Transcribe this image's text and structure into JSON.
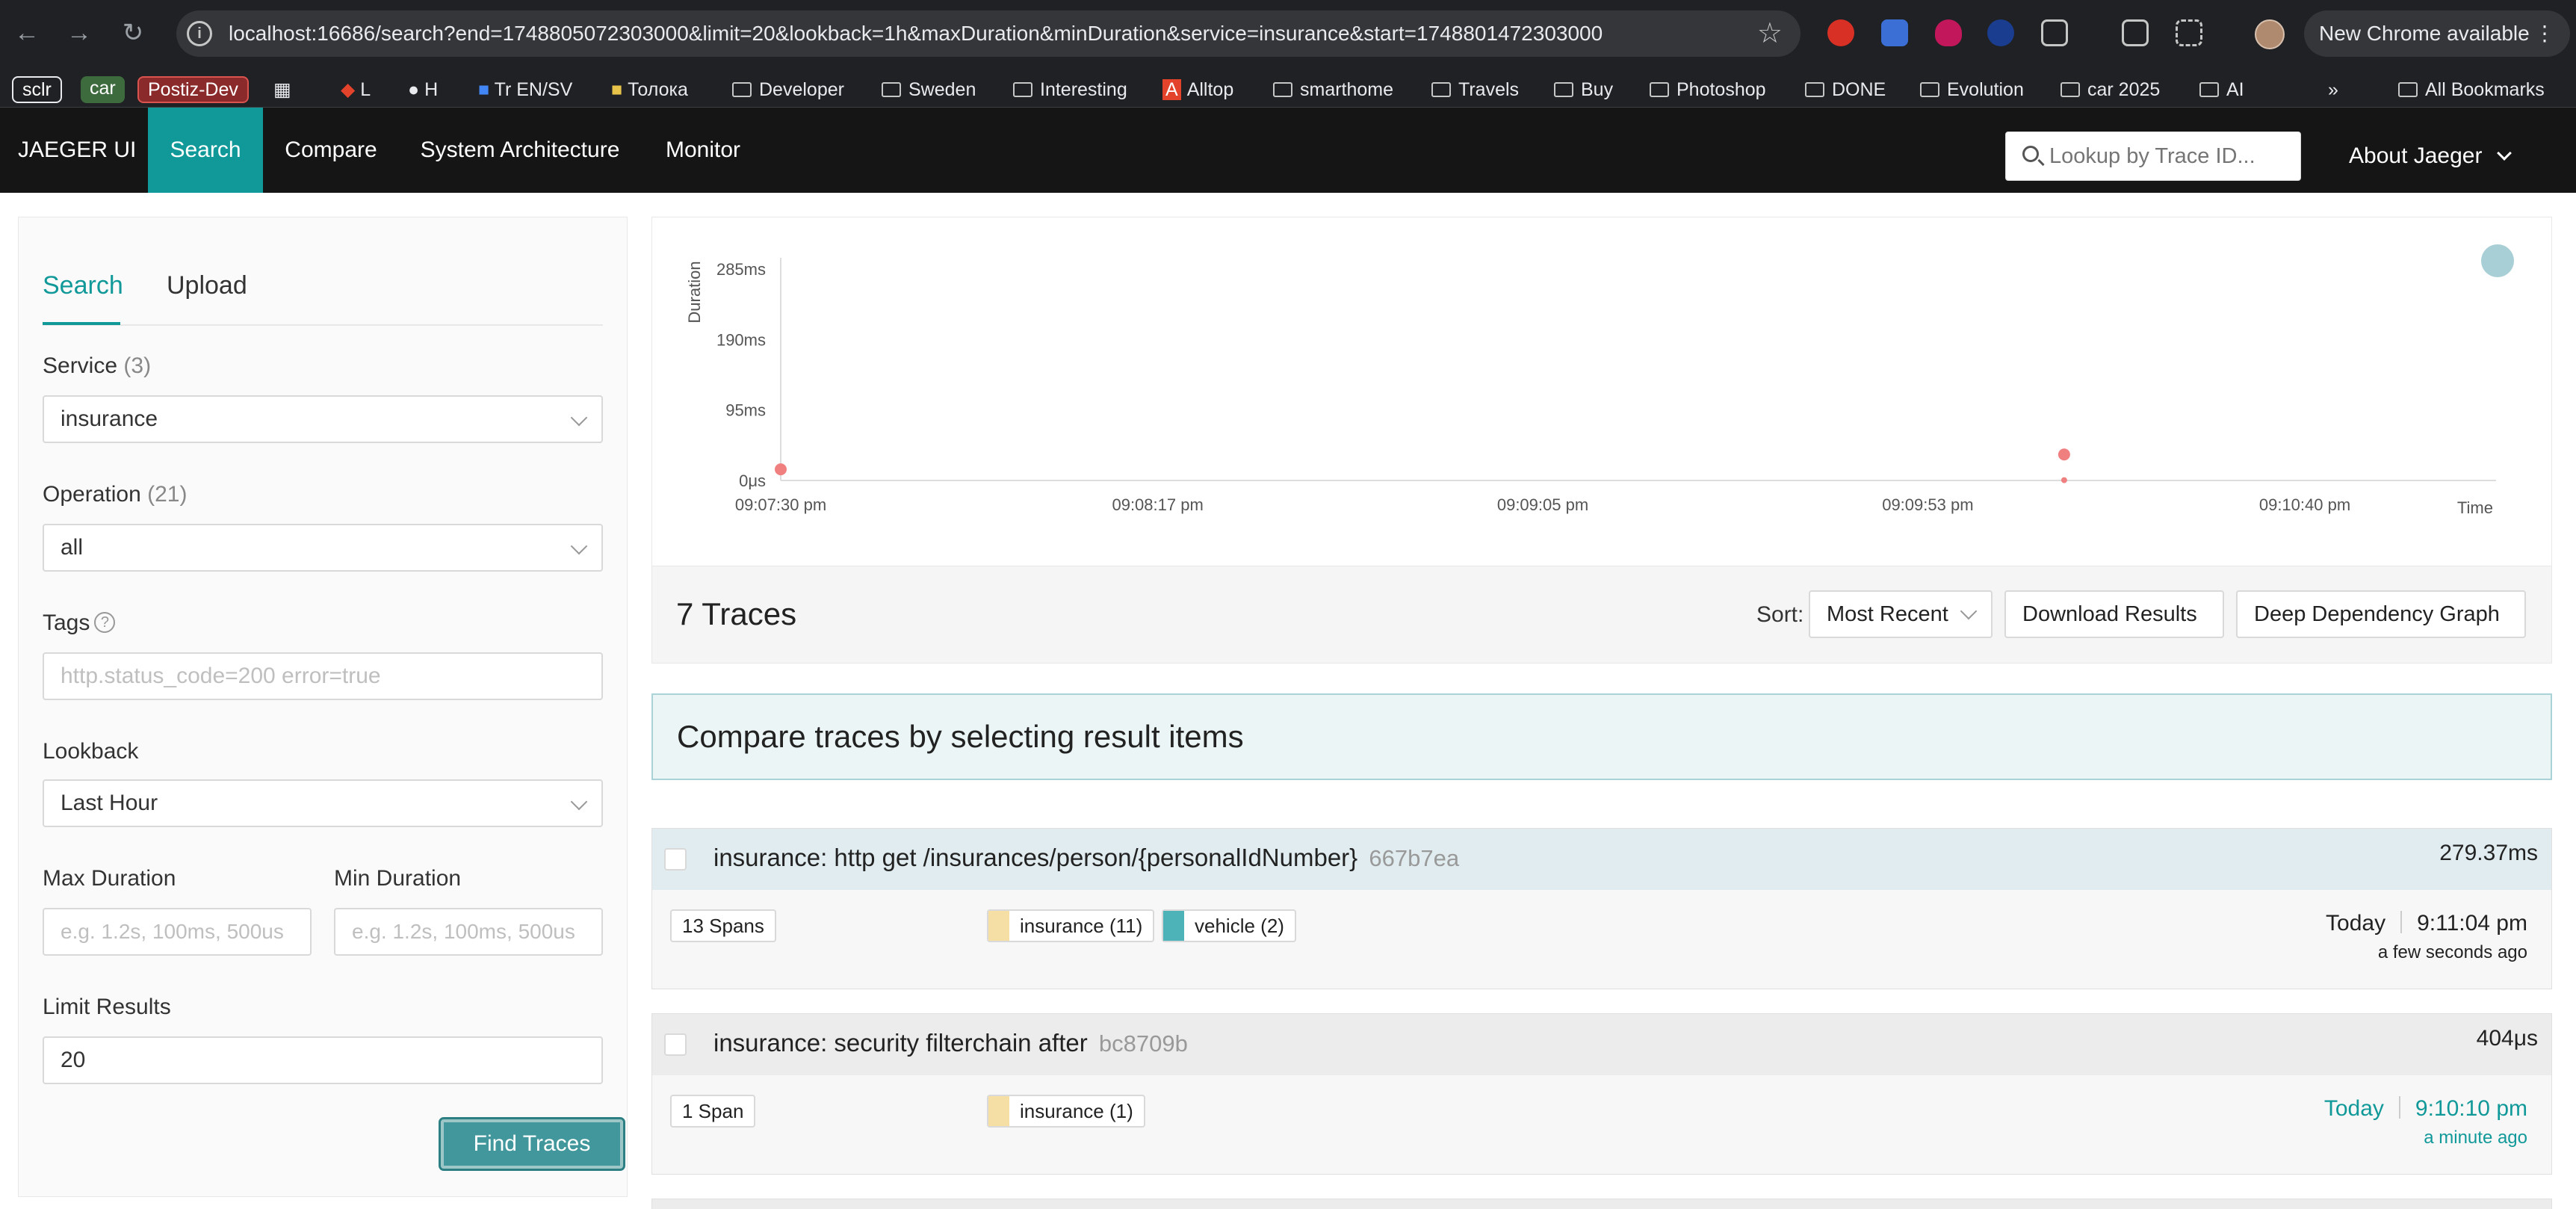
{
  "browser": {
    "url": "localhost:16686/search?end=1748805072303000&limit=20&lookback=1h&maxDuration&minDuration&service=insurance&start=1748801472303000",
    "new_chrome": "New Chrome available",
    "bookmarks": [
      {
        "label": "sclr",
        "type": "pill"
      },
      {
        "label": "car",
        "type": "pill"
      },
      {
        "label": "Postiz-Dev",
        "type": "pill"
      },
      {
        "label": "L"
      },
      {
        "label": "H"
      },
      {
        "label": "Tr EN/SV"
      },
      {
        "label": "Толока"
      },
      {
        "label": "Developer"
      },
      {
        "label": "Sweden"
      },
      {
        "label": "Interesting"
      },
      {
        "label": "Alltop"
      },
      {
        "label": "smarthome"
      },
      {
        "label": "Travels"
      },
      {
        "label": "Buy"
      },
      {
        "label": "Photoshop"
      },
      {
        "label": "DONE"
      },
      {
        "label": "Evolution"
      },
      {
        "label": "car 2025"
      },
      {
        "label": "AI"
      },
      {
        "label": "All Bookmarks"
      }
    ]
  },
  "nav": {
    "brand": "JAEGER UI",
    "items": [
      "Search",
      "Compare",
      "System Architecture",
      "Monitor"
    ],
    "active": "Search",
    "lookup_placeholder": "Lookup by Trace ID...",
    "about": "About Jaeger"
  },
  "search_form": {
    "tabs": [
      "Search",
      "Upload"
    ],
    "service_label": "Service",
    "service_count": "(3)",
    "service_value": "insurance",
    "operation_label": "Operation",
    "operation_count": "(21)",
    "operation_value": "all",
    "tags_label": "Tags",
    "tags_placeholder": "http.status_code=200 error=true",
    "lookback_label": "Lookback",
    "lookback_value": "Last Hour",
    "max_duration_label": "Max Duration",
    "max_duration_placeholder": "e.g. 1.2s, 100ms, 500us",
    "min_duration_label": "Min Duration",
    "min_duration_placeholder": "e.g. 1.2s, 100ms, 500us",
    "limit_label": "Limit Results",
    "limit_value": "20",
    "find_button": "Find Traces"
  },
  "chart_data": {
    "type": "scatter",
    "ylabel": "Duration",
    "xlabel": "Time",
    "y_ticks": [
      "0μs",
      "95ms",
      "190ms",
      "285ms"
    ],
    "x_ticks": [
      "09:07:30 pm",
      "09:08:17 pm",
      "09:09:05 pm",
      "09:09:53 pm",
      "09:10:40 pm"
    ],
    "points": [
      {
        "time": "09:07:30 pm",
        "duration_ms": 15,
        "color": "#f08080"
      },
      {
        "time": "09:10:10 pm",
        "duration_ms": 35,
        "color": "#f08080"
      },
      {
        "time": "09:10:10 pm",
        "duration_ms": 0.4,
        "color": "#f08080"
      },
      {
        "time": "09:11:04 pm",
        "duration_ms": 279.37,
        "color": "#a8cfd6"
      }
    ]
  },
  "results": {
    "count_text": "7 Traces",
    "sort_label": "Sort:",
    "sort_value": "Most Recent",
    "download_button": "Download Results",
    "ddg_button": "Deep Dependency Graph",
    "compare_hint": "Compare traces by selecting result items"
  },
  "traces": [
    {
      "name": "insurance: http get /insurances/person/{personalIdNumber}",
      "id": "667b7ea",
      "duration": "279.37ms",
      "spans": "13 Spans",
      "services": [
        {
          "label": "insurance (11)",
          "color": "#f5dfa4"
        },
        {
          "label": "vehicle (2)",
          "color": "#4db3b8"
        }
      ],
      "day": "Today",
      "time": "9:11:04 pm",
      "ago": "a few seconds ago",
      "header_color": "#e0ecef"
    },
    {
      "name": "insurance: security filterchain after",
      "id": "bc8709b",
      "duration": "404μs",
      "spans": "1 Span",
      "services": [
        {
          "label": "insurance (1)",
          "color": "#f5dfa4"
        }
      ],
      "day": "Today",
      "time": "9:10:10 pm",
      "ago": "a minute ago",
      "header_color": "#ececec"
    }
  ]
}
